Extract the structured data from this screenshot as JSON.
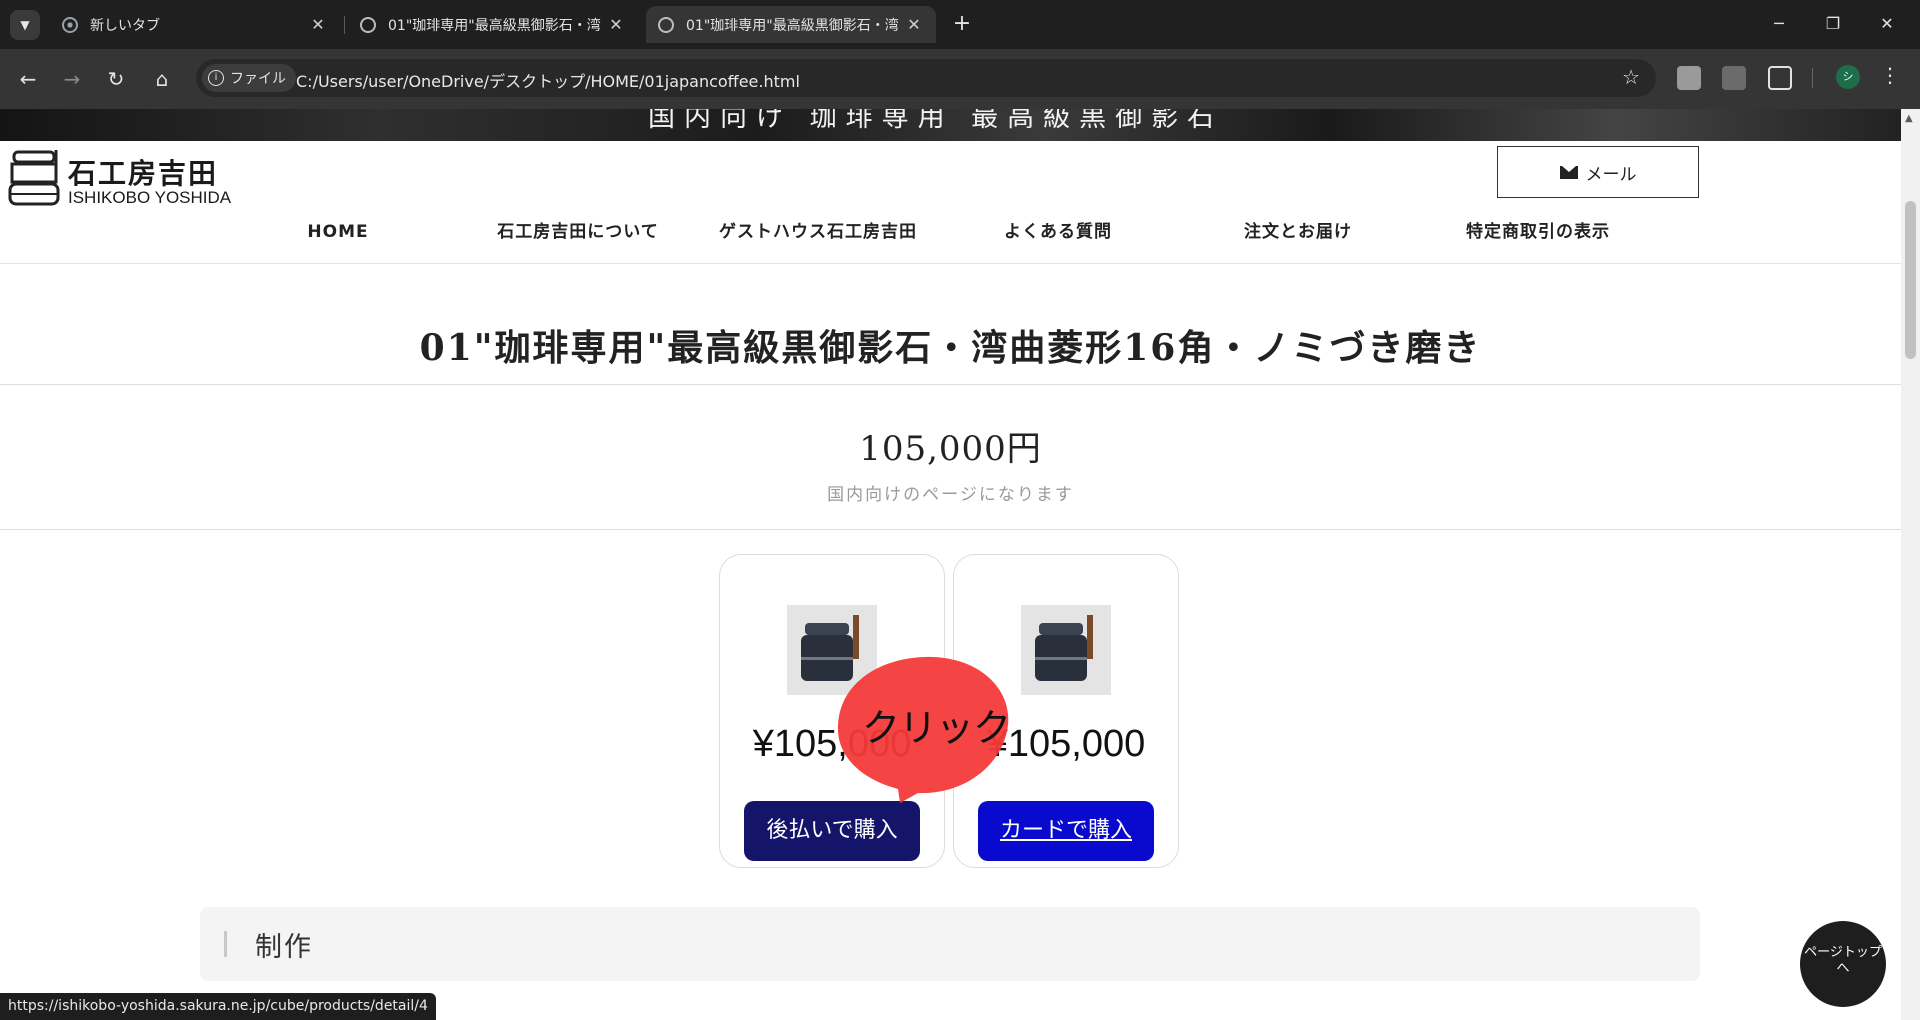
{
  "browser": {
    "tabs": [
      {
        "title": "新しいタブ",
        "active": false
      },
      {
        "title": "01\"珈琲専用\"最高級黒御影石・湾",
        "active": false
      },
      {
        "title": "01\"珈琲専用\"最高級黒御影石・湾",
        "active": true
      }
    ],
    "address_chip": "ファイル",
    "url": "C:/Users/user/OneDrive/デスクトップ/HOME/01japancoffee.html",
    "profile_initial": "シ",
    "status_url": "https://ishikobo-yoshida.sakura.ne.jp/cube/products/detail/4"
  },
  "hero": {
    "text": "国内向け 珈琲専用 最高級黒御影石"
  },
  "header": {
    "logo_jp": "石工房吉田",
    "logo_en": "ISHIKOBO YOSHIDA",
    "mail_label": "メール",
    "nav": [
      "HOME",
      "石工房吉田について",
      "ゲストハウス石工房吉田",
      "よくある質問",
      "注文とお届け",
      "特定商取引の表示"
    ]
  },
  "product": {
    "title": "01\"珈琲専用\"最高級黒御影石・湾曲菱形16角・ノミづき磨き",
    "price": "105,000円",
    "note": "国内向けのページになります",
    "cards": [
      {
        "price": "¥105,000",
        "button": "後払いで購入"
      },
      {
        "price": "¥105,000",
        "button": "カードで購入"
      }
    ]
  },
  "annotation": {
    "text": "クリック",
    "color": "#f43a3a"
  },
  "section": {
    "title": "制作"
  },
  "pagetop": {
    "label": "ページトップへ"
  },
  "colors": {
    "later_button": "#14146b",
    "card_button": "#0a0acf",
    "chrome_dark": "#1f1f1f"
  }
}
